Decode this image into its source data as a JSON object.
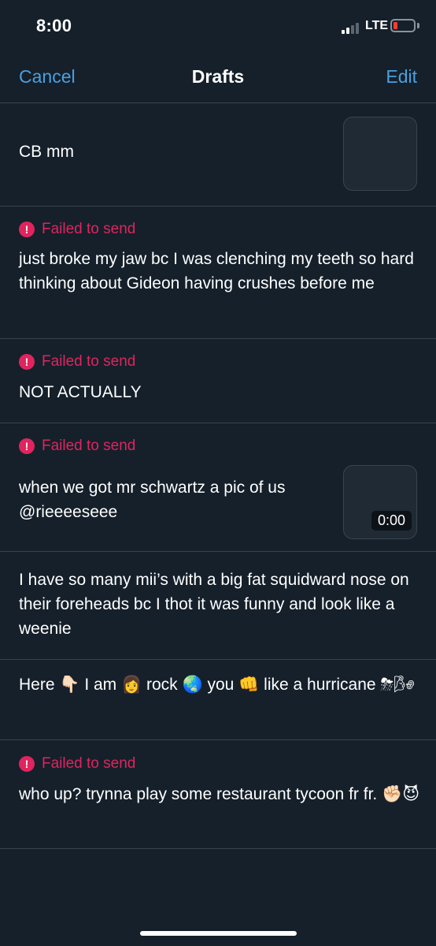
{
  "status_bar": {
    "time": "8:00",
    "network": "LTE",
    "signal_bars_active": 2,
    "signal_bars_total": 4,
    "battery_level": 0.1
  },
  "nav": {
    "cancel_label": "Cancel",
    "title": "Drafts",
    "edit_label": "Edit"
  },
  "drafts": [
    {
      "failed": false,
      "text": "CB mm",
      "has_media": true
    },
    {
      "failed": true,
      "failed_label": "Failed to send",
      "text": "just broke my jaw bc I was clenching my teeth so hard thinking about Gideon having crushes before me"
    },
    {
      "failed": true,
      "failed_label": "Failed to send",
      "text": "NOT ACTUALLY"
    },
    {
      "failed": true,
      "failed_label": "Failed to send",
      "text": "when we got mr schwartz a pic of us @rieeeeseee",
      "has_media": true,
      "media_duration": "0:00"
    },
    {
      "failed": false,
      "text": "I have so many mii’s with a big fat squidward nose on their foreheads bc I thot it was funny and look like a weenie"
    },
    {
      "failed": false,
      "text": "Here 👇🏻 I am 👩 rock 🌏 you 👊 like a hurricane ⛈🌬"
    },
    {
      "failed": true,
      "failed_label": "Failed to send",
      "text": "who up? trynna play some restaurant tycoon fr fr. ✊🏻😈"
    }
  ],
  "colors": {
    "background": "#15202b",
    "accent": "#4b9fe0",
    "error": "#e0245e",
    "divider": "#38444d"
  }
}
